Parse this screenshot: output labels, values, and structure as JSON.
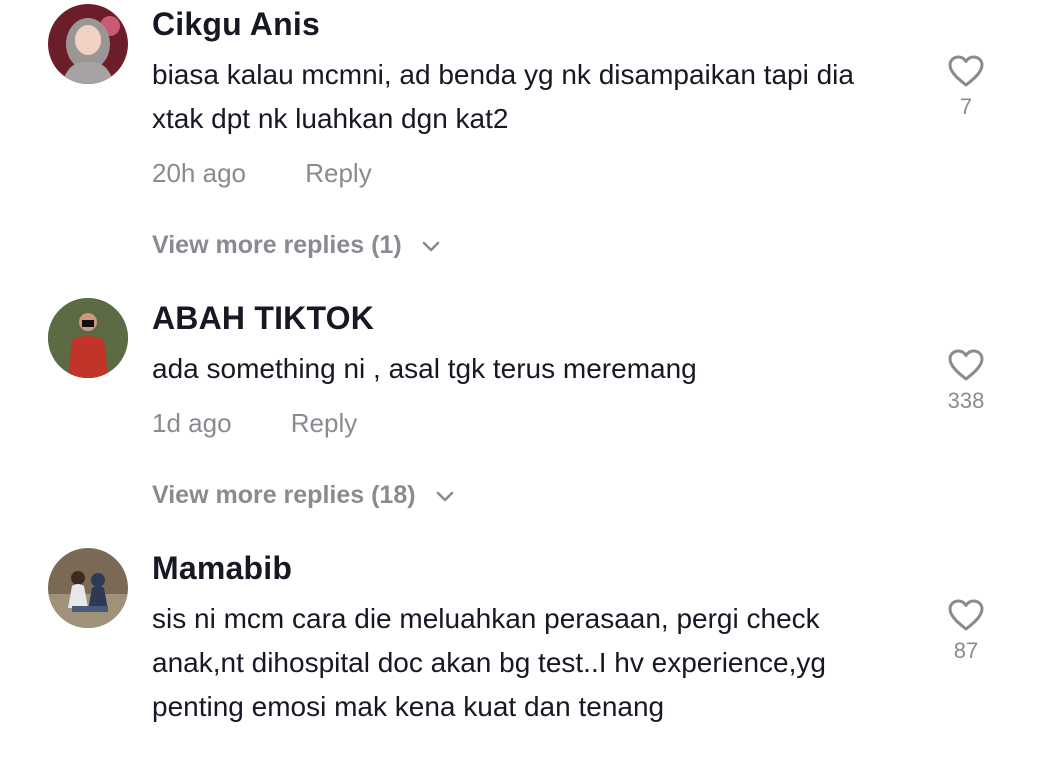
{
  "comments": [
    {
      "username": "Cikgu Anis",
      "text": "biasa kalau mcmni, ad benda yg nk disampaikan tapi dia xtak dpt nk luahkan dgn kat2",
      "time": "20h ago",
      "reply_label": "Reply",
      "likes": "7",
      "view_more": "View more replies (1)",
      "icon_heart": "heart-outline-icon"
    },
    {
      "username": "ABAH TIKTOK",
      "text": "ada something ni , asal tgk terus meremang",
      "time": "1d ago",
      "reply_label": "Reply",
      "likes": "338",
      "view_more": "View more replies (18)",
      "icon_heart": "heart-outline-icon"
    },
    {
      "username": "Mamabib",
      "text": "sis ni mcm cara die meluahkan perasaan, pergi check anak,nt dihospital doc akan bg test..I hv experience,yg penting emosi mak kena kuat dan tenang",
      "likes": "87",
      "icon_heart": "heart-outline-icon"
    }
  ],
  "colors": {
    "primary_text": "#161823",
    "secondary_text": "#8a8b91",
    "background": "#ffffff"
  }
}
